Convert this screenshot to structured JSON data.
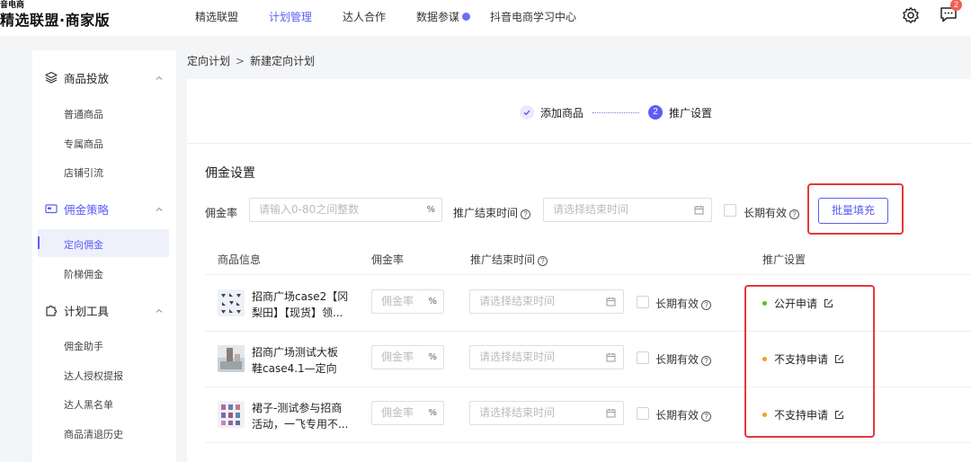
{
  "brand": {
    "top": "音电商",
    "name": "精选联盟·商家版"
  },
  "nav": [
    {
      "label": "精选联盟",
      "active": false
    },
    {
      "label": "计划管理",
      "active": true
    },
    {
      "label": "达人合作",
      "active": false
    },
    {
      "label": "数据参谋",
      "active": false,
      "dot": true
    },
    {
      "label": "抖音电商学习中心",
      "active": false
    }
  ],
  "header": {
    "message_count": "2",
    "settings_icon": "gear-icon",
    "message_icon": "message-icon"
  },
  "sidebar": {
    "sections": [
      {
        "title": "商品投放",
        "icon": "layers-icon",
        "items": [
          "普通商品",
          "专属商品",
          "店铺引流"
        ]
      },
      {
        "title": "佣金策略",
        "icon": "card-icon",
        "active": true,
        "items": [
          "定向佣金",
          "阶梯佣金"
        ]
      },
      {
        "title": "计划工具",
        "icon": "puzzle-icon",
        "items": [
          "佣金助手",
          "达人授权提报",
          "达人黑名单",
          "商品清退历史"
        ]
      }
    ],
    "active_item": "定向佣金"
  },
  "breadcrumb": {
    "parent": "定向计划",
    "separator": ">",
    "current": "新建定向计划"
  },
  "steps": {
    "step1": "添加商品",
    "step2_num": "2",
    "step2": "推广设置"
  },
  "commission": {
    "title": "佣金设置",
    "rate_label": "佣金率",
    "rate_placeholder": "请输入0-80之间整数",
    "rate_suffix": "%",
    "end_label": "推广结束时间",
    "end_placeholder": "请选择结束时间",
    "long_term": "长期有效",
    "batch_button": "批量填充"
  },
  "table": {
    "headers": {
      "product": "商品信息",
      "rate": "佣金率",
      "end_time": "推广结束时间",
      "promo": "推广设置"
    },
    "rows": [
      {
        "name_line1": "招商广场case2【冈",
        "name_line2": "梨田】【现货】领...",
        "rate_placeholder": "佣金率",
        "suffix": "%",
        "end_placeholder": "请选择结束时间",
        "long_term": "长期有效",
        "status": "公开申请",
        "status_color": "#52c41a"
      },
      {
        "name_line1": "招商广场测试大板",
        "name_line2": "鞋case4.1—定向",
        "rate_placeholder": "佣金率",
        "suffix": "%",
        "end_placeholder": "请选择结束时间",
        "long_term": "长期有效",
        "status": "不支持申请",
        "status_color": "#fa9c1b"
      },
      {
        "name_line1": "裙子-测试参与招商",
        "name_line2": "活动，一飞专用不...",
        "rate_placeholder": "佣金率",
        "suffix": "%",
        "end_placeholder": "请选择结束时间",
        "long_term": "长期有效",
        "status": "不支持申请",
        "status_color": "#fa9c1b"
      }
    ]
  },
  "colors": {
    "accent": "#5b5ef5",
    "highlight": "#e6373f"
  }
}
